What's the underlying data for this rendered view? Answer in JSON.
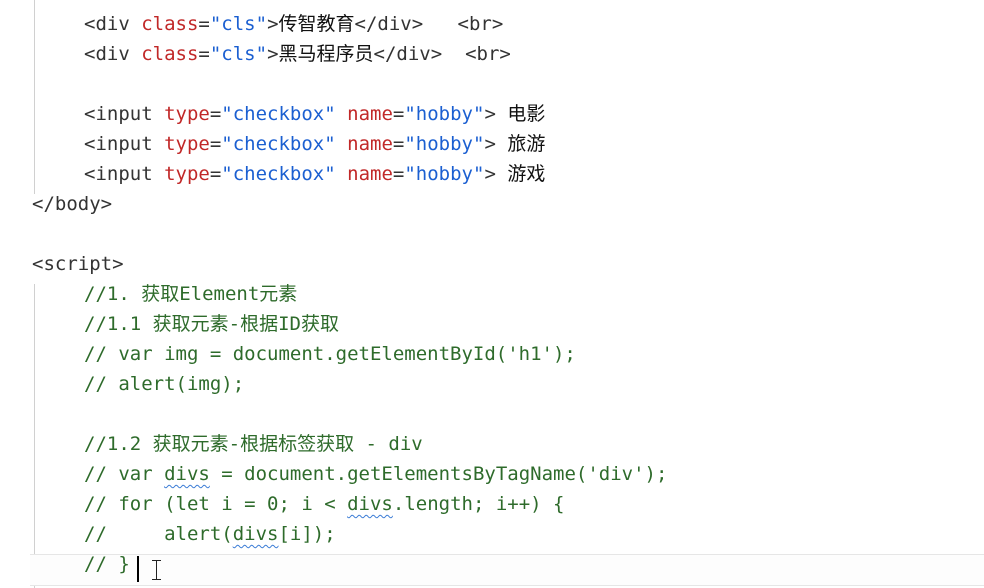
{
  "editor": {
    "lines": [
      {
        "tokens": [
          {
            "t": "<div ",
            "c": "tag"
          },
          {
            "t": "class",
            "c": "attr"
          },
          {
            "t": "=",
            "c": "tag"
          },
          {
            "t": "\"cls\"",
            "c": "str"
          },
          {
            "t": ">",
            "c": "tag"
          },
          {
            "t": "传智教育",
            "c": "txt"
          },
          {
            "t": "</div>",
            "c": "tag"
          },
          {
            "t": "   ",
            "c": "tag"
          },
          {
            "t": "<br>",
            "c": "tag"
          }
        ]
      },
      {
        "tokens": [
          {
            "t": "<div ",
            "c": "tag"
          },
          {
            "t": "class",
            "c": "attr"
          },
          {
            "t": "=",
            "c": "tag"
          },
          {
            "t": "\"cls\"",
            "c": "str"
          },
          {
            "t": ">",
            "c": "tag"
          },
          {
            "t": "黑马程序员",
            "c": "txt"
          },
          {
            "t": "</div>",
            "c": "tag"
          },
          {
            "t": "  ",
            "c": "tag"
          },
          {
            "t": "<br>",
            "c": "tag"
          }
        ]
      },
      {
        "tokens": []
      },
      {
        "tokens": [
          {
            "t": "<input ",
            "c": "tag"
          },
          {
            "t": "type",
            "c": "attr"
          },
          {
            "t": "=",
            "c": "tag"
          },
          {
            "t": "\"checkbox\"",
            "c": "str"
          },
          {
            "t": " ",
            "c": "tag"
          },
          {
            "t": "name",
            "c": "attr"
          },
          {
            "t": "=",
            "c": "tag"
          },
          {
            "t": "\"hobby\"",
            "c": "str"
          },
          {
            "t": ">",
            "c": "tag"
          },
          {
            "t": " 电影",
            "c": "txt"
          }
        ]
      },
      {
        "tokens": [
          {
            "t": "<input ",
            "c": "tag"
          },
          {
            "t": "type",
            "c": "attr"
          },
          {
            "t": "=",
            "c": "tag"
          },
          {
            "t": "\"checkbox\"",
            "c": "str"
          },
          {
            "t": " ",
            "c": "tag"
          },
          {
            "t": "name",
            "c": "attr"
          },
          {
            "t": "=",
            "c": "tag"
          },
          {
            "t": "\"hobby\"",
            "c": "str"
          },
          {
            "t": ">",
            "c": "tag"
          },
          {
            "t": " 旅游",
            "c": "txt"
          }
        ]
      },
      {
        "tokens": [
          {
            "t": "<input ",
            "c": "tag"
          },
          {
            "t": "type",
            "c": "attr"
          },
          {
            "t": "=",
            "c": "tag"
          },
          {
            "t": "\"checkbox\"",
            "c": "str"
          },
          {
            "t": " ",
            "c": "tag"
          },
          {
            "t": "name",
            "c": "attr"
          },
          {
            "t": "=",
            "c": "tag"
          },
          {
            "t": "\"hobby\"",
            "c": "str"
          },
          {
            "t": ">",
            "c": "tag"
          },
          {
            "t": " 游戏",
            "c": "txt"
          }
        ]
      },
      {
        "tokens": [
          {
            "t": "</body>",
            "c": "tag"
          }
        ]
      },
      {
        "tokens": []
      },
      {
        "tokens": [
          {
            "t": "<script>",
            "c": "tag"
          }
        ]
      },
      {
        "tokens": [
          {
            "t": "//1. 获取Element元素",
            "c": "com"
          }
        ]
      },
      {
        "tokens": [
          {
            "t": "//1.1 获取元素-根据ID获取",
            "c": "com"
          }
        ]
      },
      {
        "tokens": [
          {
            "t": "// var img = document.getElementById('h1');",
            "c": "com"
          }
        ]
      },
      {
        "tokens": [
          {
            "t": "// alert(img);",
            "c": "com"
          }
        ]
      },
      {
        "tokens": []
      },
      {
        "tokens": [
          {
            "t": "//1.2 获取元素-根据标签获取 - div",
            "c": "com"
          }
        ]
      },
      {
        "tokens": [
          {
            "t": "// var ",
            "c": "com"
          },
          {
            "t": "divs",
            "c": "com squig"
          },
          {
            "t": " = document.getElementsByTagName('div');",
            "c": "com"
          }
        ]
      },
      {
        "tokens": [
          {
            "t": "// for (let i = 0; i < ",
            "c": "com"
          },
          {
            "t": "divs",
            "c": "com squig"
          },
          {
            "t": ".length; i++) {",
            "c": "com"
          }
        ]
      },
      {
        "tokens": [
          {
            "t": "//     alert(",
            "c": "com"
          },
          {
            "t": "divs",
            "c": "com squig"
          },
          {
            "t": "[i]);",
            "c": "com"
          }
        ]
      },
      {
        "tokens": [
          {
            "t": "// }",
            "c": "com"
          }
        ]
      }
    ]
  }
}
